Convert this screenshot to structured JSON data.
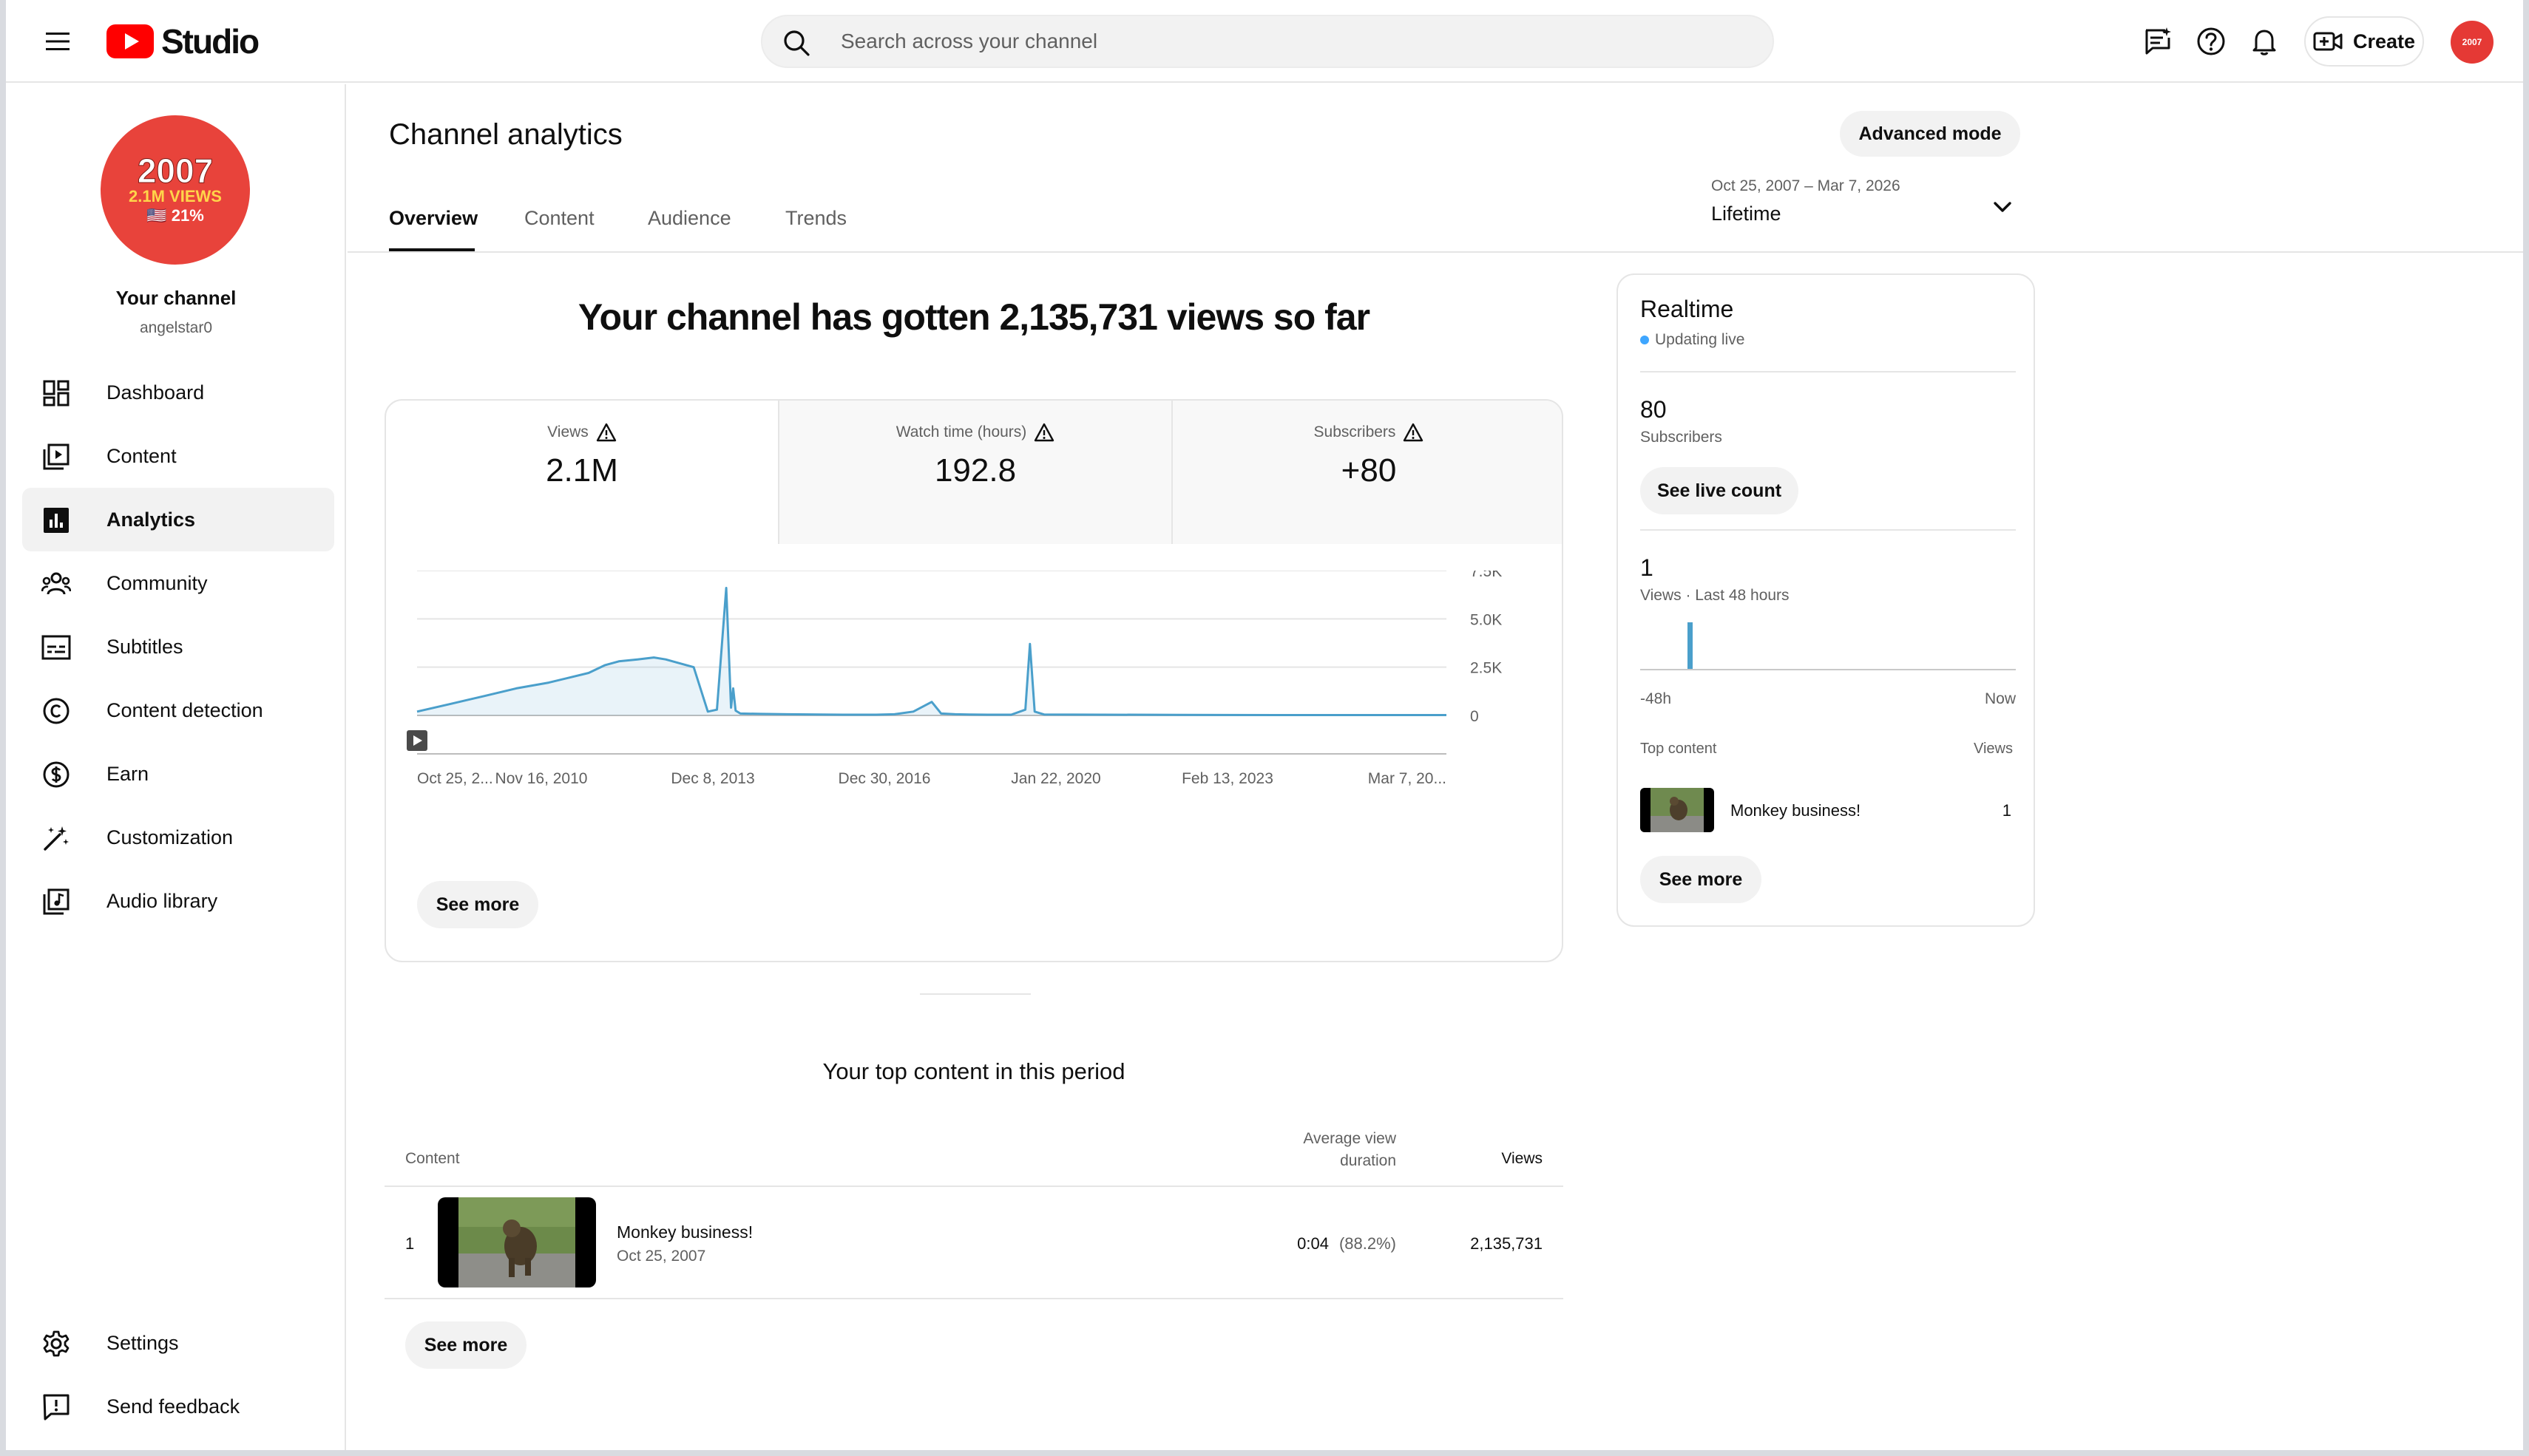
{
  "app": {
    "logo_text": "Studio"
  },
  "search": {
    "placeholder": "Search across your channel"
  },
  "topbar": {
    "create_label": "Create",
    "avatar_text": "2007"
  },
  "sidebar": {
    "channel_avatar": {
      "line1": "2007",
      "line2": "2.1M VIEWS",
      "line3": "🇺🇸 21%"
    },
    "channel_title": "Your channel",
    "channel_handle": "angelstar0",
    "items": [
      {
        "label": "Dashboard",
        "icon": "dashboard-icon"
      },
      {
        "label": "Content",
        "icon": "content-icon"
      },
      {
        "label": "Analytics",
        "icon": "analytics-icon",
        "active": true
      },
      {
        "label": "Community",
        "icon": "community-icon"
      },
      {
        "label": "Subtitles",
        "icon": "subtitles-icon"
      },
      {
        "label": "Content detection",
        "icon": "copyright-icon"
      },
      {
        "label": "Earn",
        "icon": "dollar-icon"
      },
      {
        "label": "Customization",
        "icon": "magic-wand-icon"
      },
      {
        "label": "Audio library",
        "icon": "audio-library-icon"
      }
    ],
    "footer_items": [
      {
        "label": "Settings",
        "icon": "gear-icon"
      },
      {
        "label": "Send feedback",
        "icon": "feedback-icon"
      }
    ]
  },
  "header": {
    "title": "Channel analytics",
    "advanced_mode_label": "Advanced mode",
    "tabs": [
      "Overview",
      "Content",
      "Audience",
      "Trends"
    ],
    "active_tab": "Overview",
    "date_range": "Oct 25, 2007 – Mar 7, 2026",
    "date_period": "Lifetime"
  },
  "overview": {
    "headline": "Your channel has gotten 2,135,731 views so far",
    "metrics": [
      {
        "label": "Views",
        "value": "2.1M"
      },
      {
        "label": "Watch time (hours)",
        "value": "192.8"
      },
      {
        "label": "Subscribers",
        "value": "+80"
      }
    ],
    "see_more_label": "See more"
  },
  "chart_data": {
    "type": "line",
    "title": "",
    "series": [
      {
        "values_x_labels": "daily views over lifetime",
        "x": [
          "2007-10-25",
          "2008-06-01",
          "2009-01-01",
          "2009-08-01",
          "2010-03-01",
          "2010-11-16",
          "2011-03-01",
          "2011-06-01",
          "2011-10-01",
          "2012-01-15",
          "2012-04-01",
          "2012-07-01",
          "2012-10-01",
          "2013-01-01",
          "2013-03-01",
          "2013-05-01",
          "2013-06-01",
          "2013-06-15",
          "2013-07-01",
          "2013-08-01",
          "2013-12-08",
          "2014-06-01",
          "2015-01-01",
          "2015-06-01",
          "2016-01-01",
          "2016-05-01",
          "2016-09-01",
          "2016-12-30",
          "2017-03-01",
          "2017-06-01",
          "2017-09-01",
          "2018-01-01",
          "2018-06-01",
          "2018-09-01",
          "2018-10-01",
          "2018-11-01",
          "2019-01-01",
          "2020-01-22",
          "2021-06-01",
          "2023-02-13",
          "2024-06-01",
          "2026-03-07"
        ],
        "values": [
          200,
          600,
          1000,
          1400,
          1700,
          2200,
          2600,
          2800,
          2900,
          3000,
          2900,
          2700,
          2500,
          200,
          300,
          6600,
          400,
          1400,
          250,
          100,
          80,
          60,
          50,
          40,
          40,
          60,
          200,
          700,
          100,
          60,
          50,
          40,
          40,
          300,
          3700,
          200,
          50,
          40,
          30,
          20,
          20,
          20
        ]
      }
    ],
    "x_tick_labels": [
      "Oct 25, 2...",
      "Nov 16, 2010",
      "Dec 8, 2013",
      "Dec 30, 2016",
      "Jan 22, 2020",
      "Feb 13, 2023",
      "Mar 7, 20..."
    ],
    "y_tick_labels": [
      "7.5K",
      "5.0K",
      "2.5K",
      "0"
    ],
    "ylim": [
      0,
      7500
    ],
    "grid": true
  },
  "realtime": {
    "title": "Realtime",
    "status": "Updating live",
    "subscribers_value": "80",
    "subscribers_label": "Subscribers",
    "see_live_count_label": "See live count",
    "views_value": "1",
    "views_label": "Views · Last 48 hours",
    "axis_start": "-48h",
    "axis_end": "Now",
    "top_content_label": "Top content",
    "views_col_label": "Views",
    "top_video": {
      "title": "Monkey business!",
      "views": "1"
    },
    "see_more_label": "See more"
  },
  "top_content": {
    "title": "Your top content in this period",
    "columns": {
      "content": "Content",
      "avd_line1": "Average view",
      "avd_line2": "duration",
      "views": "Views"
    },
    "rows": [
      {
        "rank": "1",
        "title": "Monkey business!",
        "date": "Oct 25, 2007",
        "avd": "0:04",
        "avd_pct": "(88.2%)",
        "views": "2,135,731"
      }
    ],
    "see_more_label": "See more"
  },
  "colors": {
    "brand_red": "#ff0000",
    "chart_line": "#4a9fcb",
    "live_dot": "#3ea6ff"
  }
}
